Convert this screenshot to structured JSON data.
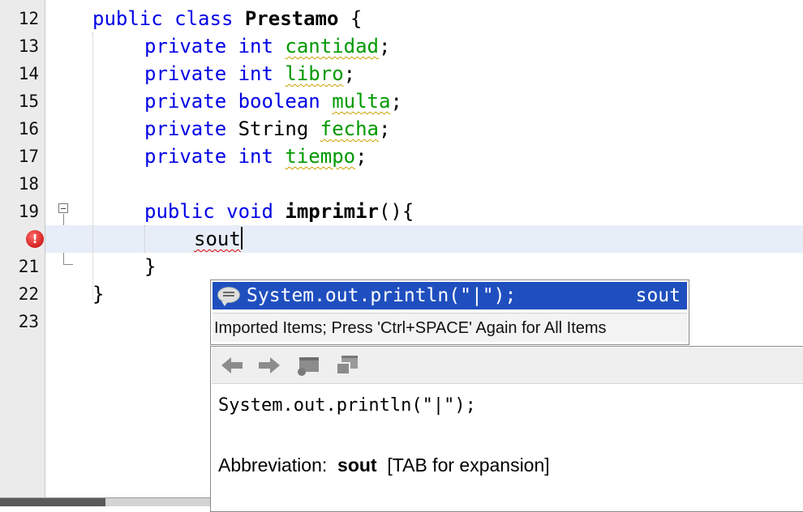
{
  "gutter": {
    "line_numbers": [
      "12",
      "13",
      "14",
      "15",
      "16",
      "17",
      "18",
      "19",
      "",
      "21",
      "22",
      "23"
    ],
    "error_line_icon": "error-icon"
  },
  "code": {
    "l12": {
      "kw": "public class ",
      "name": "Prestamo",
      "rest": " {"
    },
    "l13": {
      "kw": "private int ",
      "field": "cantidad",
      "rest": ";"
    },
    "l14": {
      "kw": "private int ",
      "field": "libro",
      "rest": ";"
    },
    "l15": {
      "kw": "private boolean ",
      "field": "multa",
      "rest": ";"
    },
    "l16": {
      "kw": "private ",
      "type": "String ",
      "field": "fecha",
      "rest": ";"
    },
    "l17": {
      "kw": "private int ",
      "field": "tiempo",
      "rest": ";"
    },
    "l19": {
      "kw": "public void ",
      "name": "imprimir",
      "rest": "(){"
    },
    "l20": {
      "typed": "sout"
    },
    "l21": {
      "rest": "}"
    },
    "l22": {
      "rest": "}"
    }
  },
  "completion": {
    "item_text": "System.out.println(\"|\");",
    "item_abbrev": "sout",
    "hint": "Imported Items; Press 'Ctrl+SPACE' Again for All Items"
  },
  "doc": {
    "code": "System.out.println(\"|\");",
    "abbr_label": "Abbreviation:  ",
    "abbr_value": "sout",
    "abbr_tail": "  [TAB for expansion]"
  },
  "colors": {
    "keyword": "#0000e6",
    "field": "#009900",
    "selection": "#1f4fbf",
    "current_line": "#e8eef8"
  }
}
